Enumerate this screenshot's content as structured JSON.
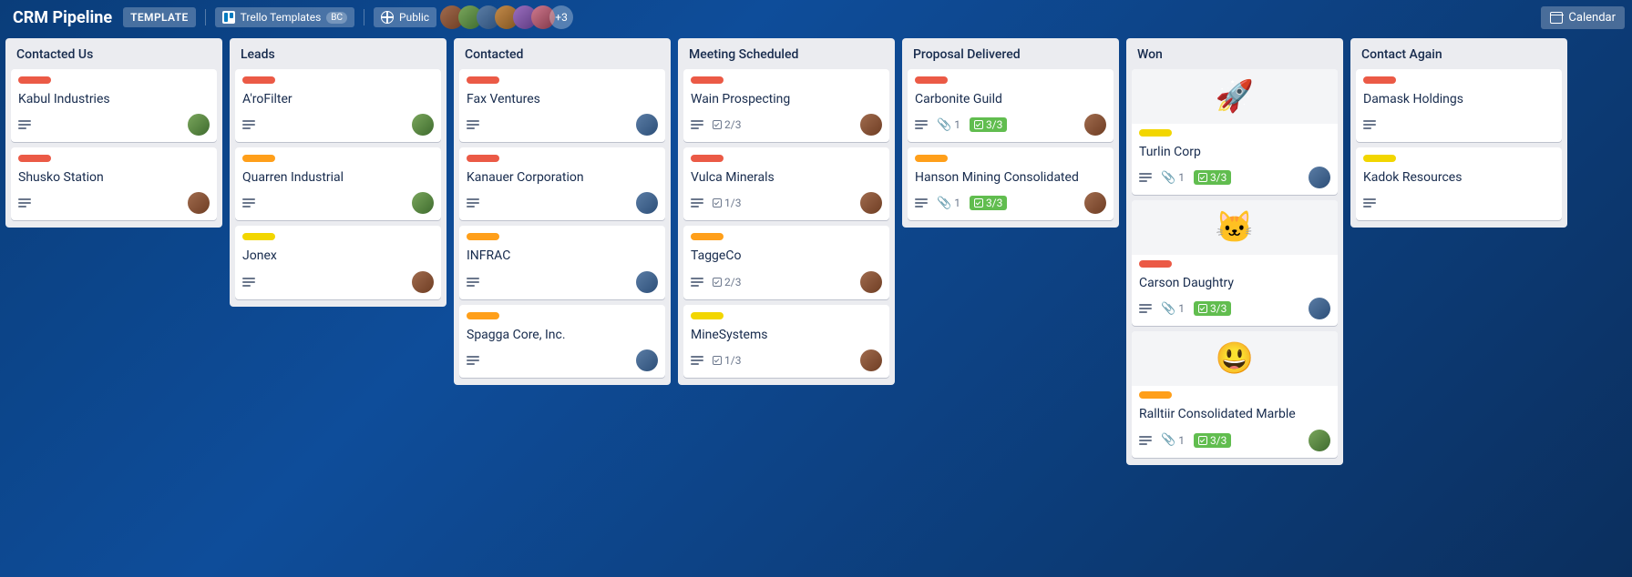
{
  "header": {
    "board_title": "CRM Pipeline",
    "template_badge": "TEMPLATE",
    "workspace_name": "Trello Templates",
    "workspace_initials": "BC",
    "visibility_label": "Public",
    "extra_members": "+3",
    "calendar_label": "Calendar"
  },
  "lists": [
    {
      "title": "Contacted Us",
      "cards": [
        {
          "label": "red",
          "title": "Kabul Industries",
          "desc": true,
          "avatar": "av1"
        },
        {
          "label": "red",
          "title": "Shusko Station",
          "desc": true,
          "avatar": "av0"
        }
      ]
    },
    {
      "title": "Leads",
      "cards": [
        {
          "label": "red",
          "title": "A'roFilter",
          "desc": true,
          "avatar": "av1"
        },
        {
          "label": "orange",
          "title": "Quarren Industrial",
          "desc": true,
          "avatar": "av1"
        },
        {
          "label": "yellow",
          "title": "Jonex",
          "desc": true,
          "avatar": "av0"
        }
      ]
    },
    {
      "title": "Contacted",
      "cards": [
        {
          "label": "red",
          "title": "Fax Ventures",
          "desc": true,
          "avatar": "av2"
        },
        {
          "label": "red",
          "title": "Kanauer Corporation",
          "desc": true,
          "avatar": "av2"
        },
        {
          "label": "orange",
          "title": "INFRAC",
          "desc": true,
          "avatar": "av2"
        },
        {
          "label": "orange",
          "title": "Spagga Core, Inc.",
          "desc": true,
          "avatar": "av2"
        }
      ]
    },
    {
      "title": "Meeting Scheduled",
      "cards": [
        {
          "label": "red",
          "title": "Wain Prospecting",
          "desc": true,
          "check": "2/3",
          "check_done": false,
          "avatar": "av0"
        },
        {
          "label": "red",
          "title": "Vulca Minerals",
          "desc": true,
          "check": "1/3",
          "check_done": false,
          "avatar": "av0"
        },
        {
          "label": "orange",
          "title": "TaggeCo",
          "desc": true,
          "check": "2/3",
          "check_done": false,
          "avatar": "av0"
        },
        {
          "label": "yellow",
          "title": "MineSystems",
          "desc": true,
          "check": "1/3",
          "check_done": false,
          "avatar": "av0"
        }
      ]
    },
    {
      "title": "Proposal Delivered",
      "cards": [
        {
          "label": "red",
          "title": "Carbonite Guild",
          "desc": true,
          "attach": "1",
          "check": "3/3",
          "check_done": true,
          "avatar": "av0"
        },
        {
          "label": "orange",
          "title": "Hanson Mining Consolidated",
          "desc": true,
          "attach": "1",
          "check": "3/3",
          "check_done": true,
          "avatar": "av0"
        }
      ]
    },
    {
      "title": "Won",
      "cards": [
        {
          "cover": "🚀",
          "label": "yellow",
          "title": "Turlin Corp",
          "desc": true,
          "attach": "1",
          "check": "3/3",
          "check_done": true,
          "avatar": "av2"
        },
        {
          "cover": "🐱",
          "label": "red",
          "title": "Carson Daughtry",
          "desc": true,
          "attach": "1",
          "check": "3/3",
          "check_done": true,
          "avatar": "av2"
        },
        {
          "cover": "😃",
          "label": "orange",
          "title": "Ralltiir Consolidated Marble",
          "desc": true,
          "attach": "1",
          "check": "3/3",
          "check_done": true,
          "avatar": "av1"
        }
      ]
    },
    {
      "title": "Contact Again",
      "cards": [
        {
          "label": "red",
          "title": "Damask Holdings",
          "desc": true
        },
        {
          "label": "yellow",
          "title": "Kadok Resources",
          "desc": true
        }
      ]
    }
  ]
}
